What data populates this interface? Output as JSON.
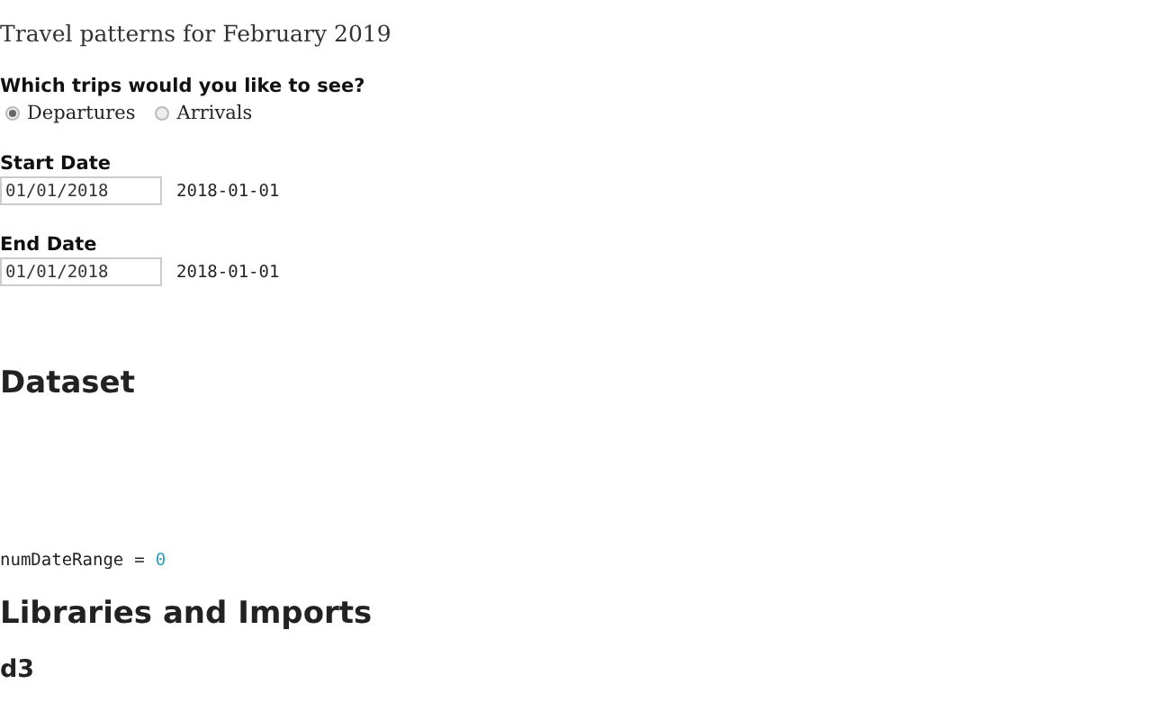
{
  "title": "Travel patterns for February 2019",
  "trip_question": {
    "label": "Which trips would you like to see?",
    "options": [
      {
        "label": "Departures",
        "selected": true
      },
      {
        "label": "Arrivals",
        "selected": false
      }
    ]
  },
  "date_fields": [
    {
      "label": "Start Date",
      "value": "01/01/2018",
      "display": "2018-01-01"
    },
    {
      "label": "End Date",
      "value": "01/01/2018",
      "display": "2018-01-01"
    }
  ],
  "dataset_heading": "Dataset",
  "code_output": {
    "name": "numDateRange",
    "operator": "=",
    "number": "0"
  },
  "libraries_heading": "Libraries and Imports",
  "d3_heading": "d3"
}
